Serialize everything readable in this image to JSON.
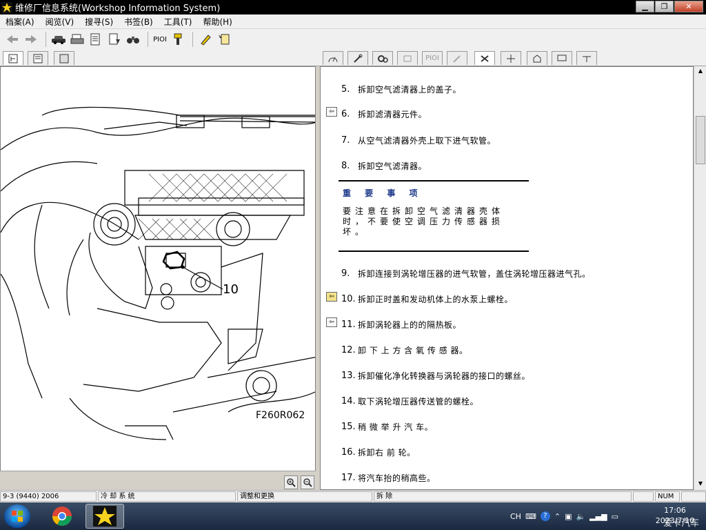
{
  "window": {
    "title": "维修厂信息系统(Workshop Information System)"
  },
  "menu": [
    "档案(A)",
    "阅览(V)",
    "搜寻(S)",
    "书签(B)",
    "工具(T)",
    "帮助(H)"
  ],
  "toolbar": {
    "pioi_label": "PIOI"
  },
  "tabs_right": {
    "pioi_label": "PIOI"
  },
  "figure": {
    "callout": "10",
    "id": "F260R062"
  },
  "steps": [
    {
      "num": "5.",
      "text": "拆卸空气滤清器上的盖子。",
      "marker": ""
    },
    {
      "num": "6.",
      "text": "拆卸滤清器元件。",
      "marker": "back"
    },
    {
      "num": "7.",
      "text": "从空气滤清器外壳上取下进气软管。",
      "marker": ""
    },
    {
      "num": "8.",
      "text": "拆卸空气滤清器。",
      "marker": ""
    },
    {
      "num": "9.",
      "text": "拆卸连接到涡轮增压器的进气软管，盖住涡轮增压器进气孔。",
      "marker": ""
    },
    {
      "num": "10.",
      "text": "拆卸正时盖和发动机体上的水泵上螺栓。",
      "marker": "back-yellow"
    },
    {
      "num": "11.",
      "text": "拆卸涡轮器上的的隔热板。",
      "marker": "back"
    },
    {
      "num": "12.",
      "text": "卸 下 上 方 含 氧 传 感 器。",
      "marker": ""
    },
    {
      "num": "13.",
      "text": "拆卸催化净化转换器与涡轮器的接口的螺丝。",
      "marker": ""
    },
    {
      "num": "14.",
      "text": "取下涡轮增压器传送管的螺栓。",
      "marker": ""
    },
    {
      "num": "15.",
      "text": "稍 微 举 升 汽 车。",
      "marker": ""
    },
    {
      "num": "16.",
      "text": "拆卸右 前 轮。",
      "marker": ""
    },
    {
      "num": "17.",
      "text": "将汽车抬的稍高些。",
      "marker": ""
    }
  ],
  "notice": {
    "heading": "重 要 事 项",
    "body": "要注意在拆卸空气滤清器壳体时，不要使空调压力传感器损坏。"
  },
  "status": {
    "vehicle": "9-3 (9440) 2006",
    "system": "冷 却 系 统",
    "group": "调整和更换",
    "operation": "拆 除",
    "num": "NUM"
  },
  "taskbar": {
    "lang": "CH",
    "time": "17:06",
    "date": "2023/7/10"
  },
  "watermark": "爱卡汽车"
}
